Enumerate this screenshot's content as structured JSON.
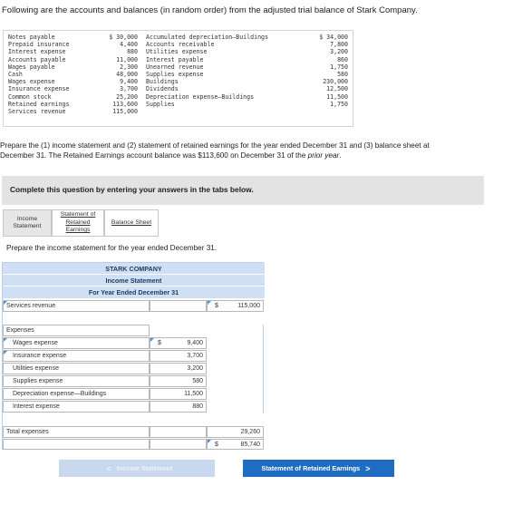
{
  "intro": "Following are the accounts and balances (in random order) from the adjusted trial balance of Stark Company.",
  "balances": {
    "col1_names": [
      "Notes payable",
      "Prepaid insurance",
      "Interest expense",
      "Accounts payable",
      "Wages payable",
      "Cash",
      "Wages expense",
      "Insurance expense",
      "Common stock",
      "Retained earnings",
      "Services revenue"
    ],
    "col1_values": [
      "$ 30,000",
      "4,400",
      "880",
      "11,000",
      "2,300",
      "48,000",
      "9,400",
      "3,700",
      "25,200",
      "113,600",
      "115,000"
    ],
    "col2_names": [
      "Accumulated depreciation—Buildings",
      "Accounts receivable",
      "Utilities expense",
      "Interest payable",
      "Unearned revenue",
      "Supplies expense",
      "Buildings",
      "Dividends",
      "Depreciation expense—Buildings",
      "Supplies"
    ],
    "col2_values": [
      "$ 34,000",
      "7,800",
      "3,200",
      "860",
      "1,750",
      "580",
      "230,000",
      "12,500",
      "11,500",
      "1,750"
    ]
  },
  "question": {
    "line1": "Prepare the (1) income statement and (2) statement of retained earnings for the year ended December 31 and (3) balance sheet at",
    "line2_prefix": "December 31. The Retained Earnings account balance was $113,600 on December 31 of the ",
    "line2_em": "prior year",
    "line2_suffix": "."
  },
  "banner": "Complete this question by entering your answers in the tabs below.",
  "tabs": {
    "income_l1": "Income",
    "income_l2": "Statement",
    "retained_l1": "Statement of",
    "retained_l2": "Retained",
    "retained_l3": "Earnings",
    "balance": "Balance Sheet"
  },
  "prepare": "Prepare the income statement for the year ended December 31.",
  "statement": {
    "company": "STARK COMPANY",
    "title": "Income Statement",
    "period": "For Year Ended December 31",
    "revenue_label": "Services revenue",
    "revenue_symbol": "$",
    "revenue_value": "115,000",
    "expenses_heading": "Expenses",
    "expense_labels": [
      "Wages expense",
      "Insurance expense",
      "Utilities expense",
      "Supplies expense",
      "Depreciation expense—Buildings",
      "Interest expense"
    ],
    "expense_values": [
      "9,400",
      "3,700",
      "3,200",
      "580",
      "11,500",
      "880"
    ],
    "expense_symbol": "$",
    "total_label": "Total expenses",
    "total_value": "29,260",
    "net_symbol": "$",
    "net_value": "85,740"
  },
  "nav": {
    "prev_label": "Income Statement",
    "next_label": "Statement of Retained Earnings",
    "prev_chevron": "<",
    "next_chevron": ">"
  },
  "colors": {
    "header_blue": "#cfe0f4",
    "button_blue": "#1f6cc3",
    "button_disabled": "#c9d7ef"
  }
}
